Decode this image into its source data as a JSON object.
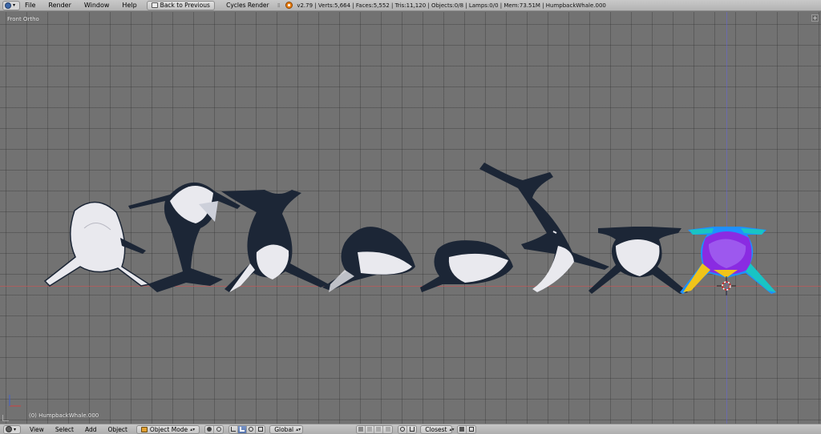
{
  "top_bar": {
    "menus": [
      "File",
      "Render",
      "Window",
      "Help"
    ],
    "back_button_label": "Back to Previous",
    "render_engine": "Cycles Render",
    "stats": "v2.79 | Verts:5,664 | Faces:5,552 | Tris:11,120 | Objects:0/8 | Lamps:0/0 | Mem:73.51M | HumpbackWhale.000"
  },
  "viewport": {
    "view_label": "Front Ortho",
    "active_object_label": "(0) HumpbackWhale.000",
    "background_color": "#727272",
    "grid_color": "#5e5e5e",
    "whale_dark_color": "#1c2636",
    "whale_light_color": "#e9e9ee",
    "selected_object_colors": [
      "#8a2be2",
      "#1e90ff",
      "#f0c419",
      "#19c4c4"
    ]
  },
  "bottom_bar": {
    "menus": [
      "View",
      "Select",
      "Add",
      "Object"
    ],
    "mode": "Object Mode",
    "orientation": "Global",
    "snap_target": "Closest"
  },
  "icons": {
    "editor_type": "blender-editor-icon",
    "back": "back-to-previous-icon",
    "logo": "blender-logo-icon",
    "cursor": "3d-cursor-icon"
  }
}
